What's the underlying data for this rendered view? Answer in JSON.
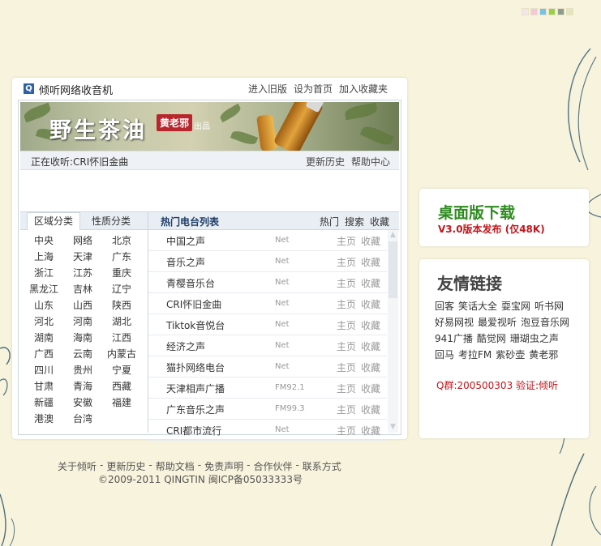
{
  "colors": {
    "background": "#f7f3dc",
    "accent_blue": "#1f3e66",
    "download_green": "#2e8b1f",
    "alert_red": "#c3151b"
  },
  "swatches": [
    "#f2e6ea",
    "#f7c6da",
    "#74c4e8",
    "#9bcf45",
    "#8a9f8a",
    "#e2e6b8"
  ],
  "header": {
    "logo_icon": "radio-logo-icon",
    "title": "倾听网络收音机",
    "links": [
      "进入旧版",
      "设为首页",
      "加入收藏夹"
    ]
  },
  "banner": {
    "title": "野生茶油",
    "seal": "黄老邪",
    "suffix": "出品"
  },
  "now_playing": {
    "text": "正在收听:CRI怀旧金曲",
    "links": [
      "更新历史",
      "帮助中心"
    ]
  },
  "tabs": [
    "区域分类",
    "性质分类"
  ],
  "regions": [
    [
      "中央",
      "网络",
      "北京"
    ],
    [
      "上海",
      "天津",
      "广东"
    ],
    [
      "浙江",
      "江苏",
      "重庆"
    ],
    [
      "黑龙江",
      "吉林",
      "辽宁"
    ],
    [
      "山东",
      "山西",
      "陕西"
    ],
    [
      "河北",
      "河南",
      "湖北"
    ],
    [
      "湖南",
      "海南",
      "江西"
    ],
    [
      "广西",
      "云南",
      "内蒙古"
    ],
    [
      "四川",
      "贵州",
      "宁夏"
    ],
    [
      "甘肃",
      "青海",
      "西藏"
    ],
    [
      "新疆",
      "安徽",
      "福建"
    ],
    [
      "港澳",
      "台湾"
    ]
  ],
  "list": {
    "title": "热门电台列表",
    "tabs": [
      "热门",
      "搜索",
      "收藏"
    ],
    "home_label": "主页",
    "fav_label": "收藏",
    "stations": [
      {
        "name": "中国之声",
        "tag": "Net"
      },
      {
        "name": "音乐之声",
        "tag": "Net"
      },
      {
        "name": "青樱音乐台",
        "tag": "Net"
      },
      {
        "name": "CRI怀旧金曲",
        "tag": "Net"
      },
      {
        "name": "Tiktok音悦台",
        "tag": "Net"
      },
      {
        "name": "经济之声",
        "tag": "Net"
      },
      {
        "name": "猫扑网络电台",
        "tag": "Net"
      },
      {
        "name": "天津相声广播",
        "tag": "FM92.1"
      },
      {
        "name": "广东音乐之声",
        "tag": "FM99.3"
      },
      {
        "name": "CRI都市流行",
        "tag": "Net"
      }
    ]
  },
  "download": {
    "title": "桌面版下载",
    "subtitle": "V3.0版本发布 (仅48K)"
  },
  "friends": {
    "title": "友情链接",
    "rows": [
      [
        "回客",
        "笑话大全",
        "耍宝网",
        "听书网"
      ],
      [
        "好易网视",
        "最爱视听",
        "泡豆音乐网"
      ],
      [
        "941广播",
        "酷觉网",
        "珊瑚虫之声"
      ],
      [
        "回马",
        "考拉FM",
        "紫砂壶",
        "黄老邪"
      ]
    ],
    "qq": "Q群:200500303 验证:倾听"
  },
  "footer": {
    "links": [
      "关于倾听",
      "更新历史",
      "帮助文档",
      "免责声明",
      "合作伙伴",
      "联系方式"
    ],
    "separator": "-",
    "copyright": "©2009-2011 QINGTIN 闽ICP备05033333号"
  }
}
